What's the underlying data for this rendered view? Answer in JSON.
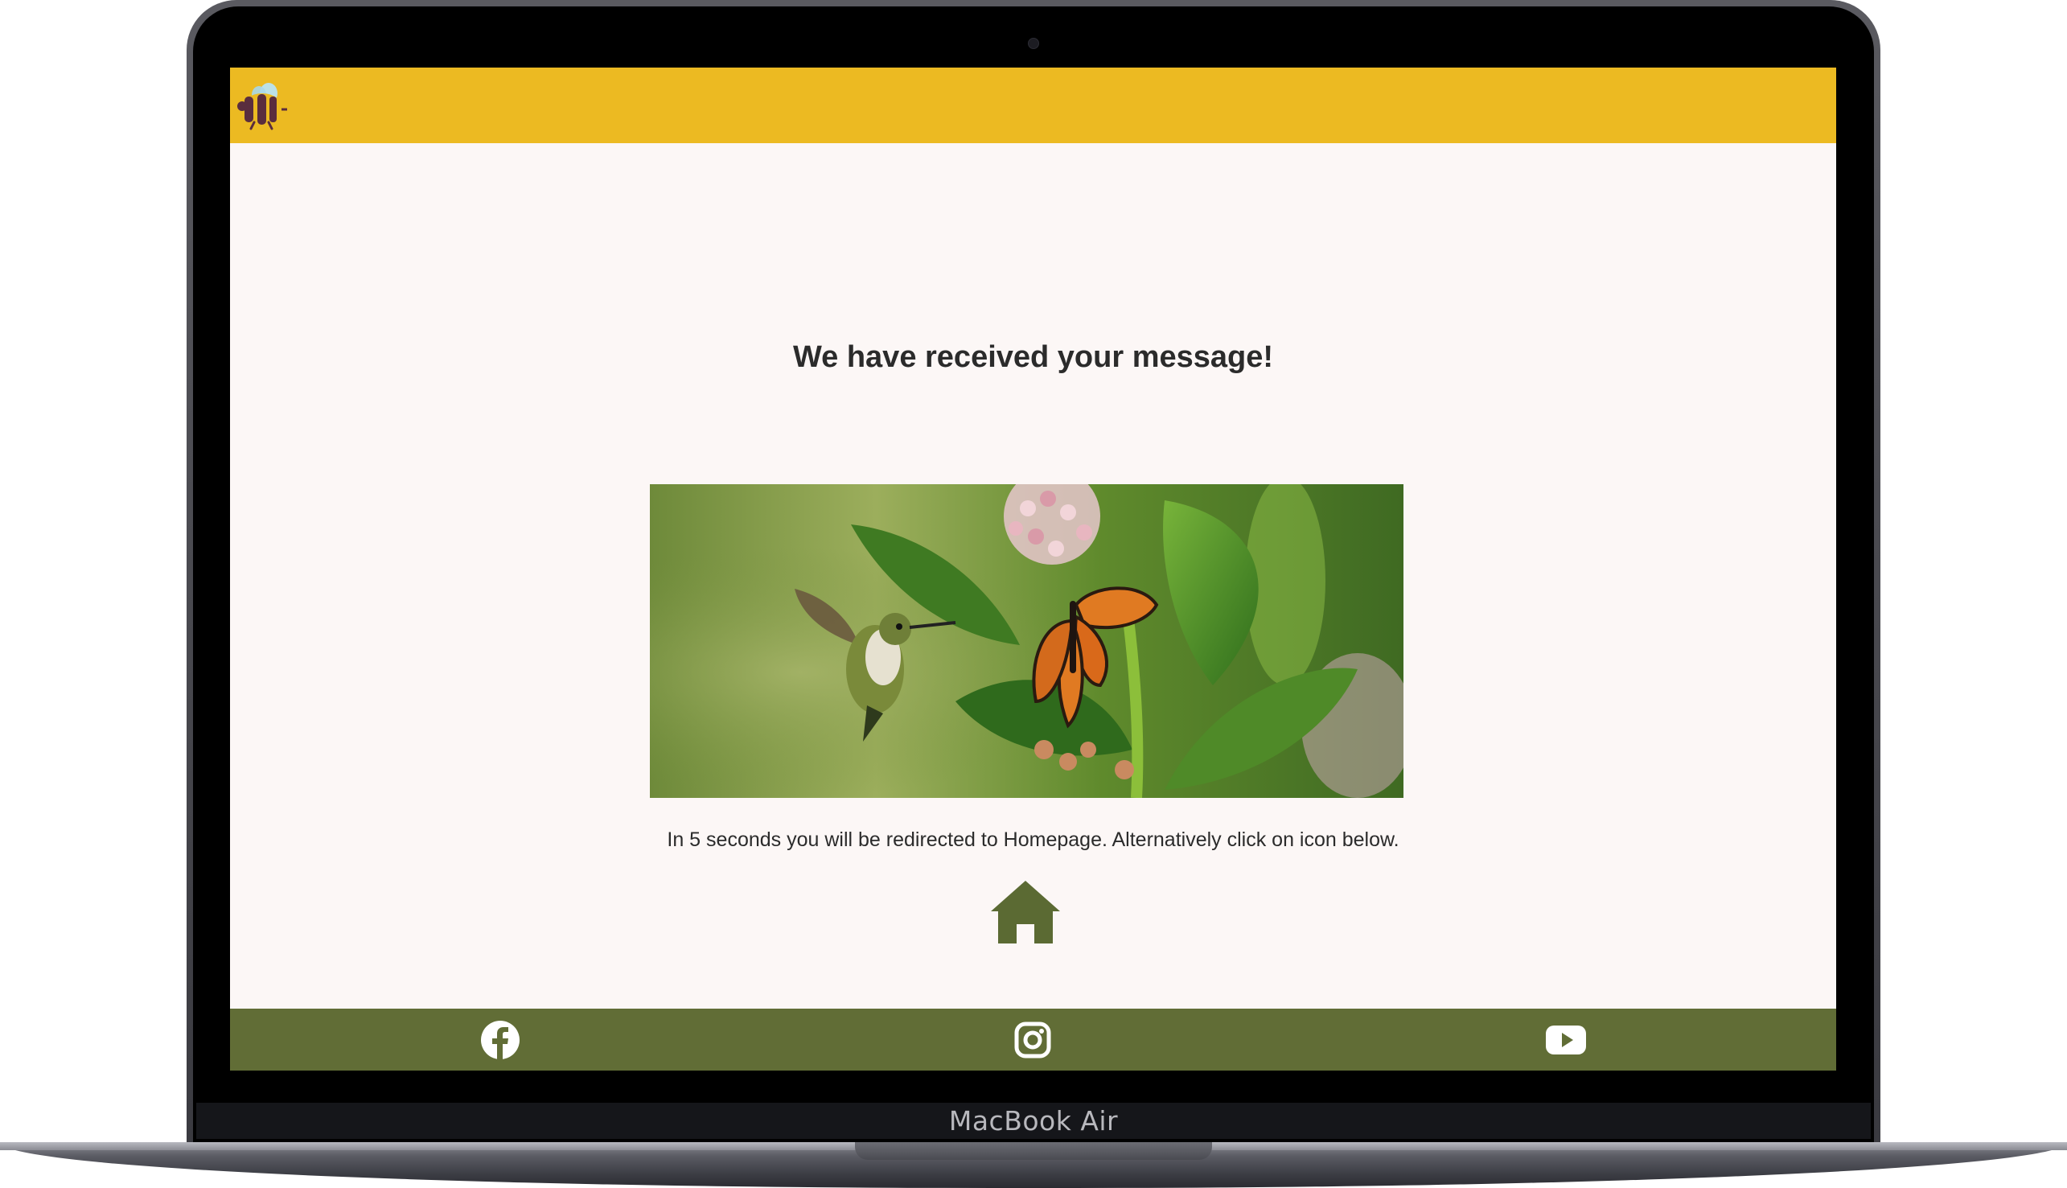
{
  "device": {
    "model_label": "MacBook Air"
  },
  "colors": {
    "header_bg": "#ecba22",
    "page_bg": "#fcf7f6",
    "footer_bg": "#616d36",
    "home_icon": "#5b6a33",
    "text": "#2b2b2b"
  },
  "header": {
    "logo_icon": "bee-icon"
  },
  "main": {
    "headline": "We have received your message!",
    "image_icon": "hummingbird-butterfly-milkweed-photo",
    "redirect_text": "In 5 seconds you will be redirected to Homepage. Alternatively click on icon below.",
    "home_icon": "home-icon"
  },
  "footer": {
    "social": [
      {
        "name": "facebook",
        "icon": "facebook-icon"
      },
      {
        "name": "instagram",
        "icon": "instagram-icon"
      },
      {
        "name": "youtube",
        "icon": "youtube-icon"
      }
    ]
  }
}
